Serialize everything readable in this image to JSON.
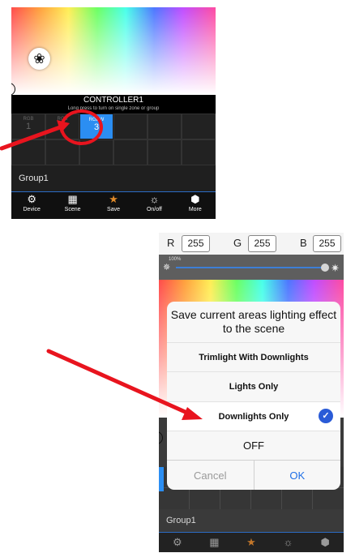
{
  "colors": {
    "accent_blue": "#2b8ef2",
    "annotation_red": "#e8141e",
    "ok_blue": "#1f6fe6",
    "check_blue": "#2a5bd7",
    "save_orange": "#c2762a"
  },
  "screen1": {
    "wheel_button_icon": "film-reel-icon",
    "controller": {
      "title": "CONTROLLER1",
      "subtitle": "Long press to turn on single zone or group"
    },
    "zones": [
      {
        "type": "RGB",
        "number": "1",
        "selected": false
      },
      {
        "type": "RGB",
        "number": "2",
        "selected": false
      },
      {
        "type": "RGBW",
        "number": "3",
        "selected": true
      }
    ],
    "group_label": "Group1",
    "tabs": [
      {
        "icon": "gear-icon",
        "glyph": "⚙",
        "label": "Device"
      },
      {
        "icon": "grid-icon",
        "glyph": "▦",
        "label": "Scene"
      },
      {
        "icon": "star-icon",
        "glyph": "★",
        "label": "Save"
      },
      {
        "icon": "bulb-icon",
        "glyph": "☼",
        "label": "On/off"
      },
      {
        "icon": "cube-icon",
        "glyph": "⬢",
        "label": "More"
      }
    ]
  },
  "screen2": {
    "rgb": {
      "r_label": "R",
      "r_value": "255",
      "g_label": "G",
      "g_value": "255",
      "b_label": "B",
      "b_value": "255"
    },
    "brightness": {
      "percent": "100%",
      "level": 1.0
    },
    "dialog": {
      "title": "Save current areas lighting effect to the scene",
      "options": [
        "Trimlight With Downlights",
        "Lights Only",
        "Downlights Only"
      ],
      "selected_option": "Downlights Only",
      "off_label": "OFF",
      "cancel_label": "Cancel",
      "ok_label": "OK"
    },
    "group_label": "Group1",
    "tabs": [
      {
        "icon": "gear-icon",
        "glyph": "⚙"
      },
      {
        "icon": "grid-icon",
        "glyph": "▦"
      },
      {
        "icon": "star-icon",
        "glyph": "★"
      },
      {
        "icon": "bulb-icon",
        "glyph": "☼"
      },
      {
        "icon": "cube-icon",
        "glyph": "⬢"
      }
    ]
  }
}
